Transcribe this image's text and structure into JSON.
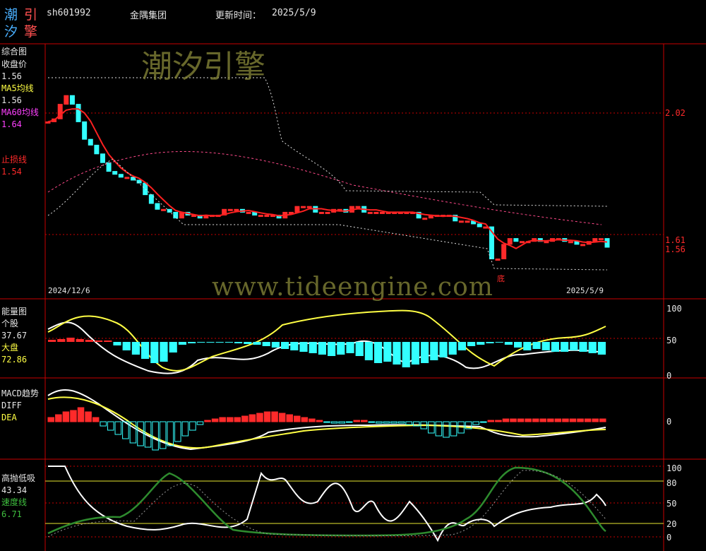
{
  "header": {
    "logo_chars": [
      "潮",
      "引",
      "汐",
      "擎"
    ],
    "code": "sh601992",
    "name": "金隅集团",
    "update_label": "更新时间：",
    "update_date": "2025/5/9"
  },
  "watermarks": {
    "cn": "潮汐引擎",
    "url": "www.tideengine.com"
  },
  "price_panel": {
    "title": "综合图",
    "close_label": "收盘价",
    "close_value": "1.56",
    "ma5_label": "MA5均线",
    "ma5_value": "1.56",
    "ma60_label": "MA60均线",
    "ma60_value": "1.64",
    "stop_label": "止损线",
    "stop_value": "1.54",
    "axis": [
      "2.02",
      "1.61",
      "1.56"
    ],
    "date_start": "2024/12/6",
    "date_end": "2025/5/9",
    "bottom_marker": "底"
  },
  "energy_panel": {
    "title": "能量图",
    "stock_label": "个股",
    "stock_value": "37.67",
    "market_label": "大盘",
    "market_value": "72.86",
    "axis": [
      "100",
      "50",
      "0"
    ]
  },
  "macd_panel": {
    "title": "MACD趋势",
    "diff_label": "DIFF",
    "dea_label": "DEA",
    "axis": [
      "0"
    ]
  },
  "kdj_panel": {
    "title": "高抛低吸",
    "value": "43.34",
    "speed_label": "速度线",
    "speed_value": "6.71",
    "axis": [
      "100",
      "80",
      "50",
      "20",
      "0"
    ]
  },
  "colors": {
    "up": "#ff2a2a",
    "down": "#33ffff",
    "grid": "#c80000",
    "ma5": "#ff2020",
    "yellow": "#ffff44",
    "green": "#2e8b2e"
  },
  "chart_data": {
    "type": "line",
    "closes": [
      1.99,
      2.0,
      2.05,
      2.08,
      2.05,
      1.99,
      1.93,
      1.91,
      1.88,
      1.85,
      1.82,
      1.81,
      1.8,
      1.8,
      1.79,
      1.78,
      1.74,
      1.71,
      1.69,
      1.69,
      1.68,
      1.66,
      1.68,
      1.67,
      1.67,
      1.66,
      1.67,
      1.67,
      1.67,
      1.69,
      1.69,
      1.69,
      1.68,
      1.68,
      1.67,
      1.67,
      1.67,
      1.67,
      1.66,
      1.68,
      1.68,
      1.7,
      1.7,
      1.7,
      1.68,
      1.68,
      1.68,
      1.69,
      1.69,
      1.68,
      1.7,
      1.7,
      1.68,
      1.68,
      1.68,
      1.68,
      1.68,
      1.68,
      1.68,
      1.68,
      1.68,
      1.66,
      1.66,
      1.67,
      1.67,
      1.67,
      1.67,
      1.65,
      1.65,
      1.65,
      1.64,
      1.63,
      1.63,
      1.52,
      1.52,
      1.57,
      1.59,
      1.58,
      1.58,
      1.58,
      1.59,
      1.58,
      1.58,
      1.59,
      1.59,
      1.58,
      1.58,
      1.57,
      1.57,
      1.58,
      1.59,
      1.59,
      1.56
    ]
  }
}
